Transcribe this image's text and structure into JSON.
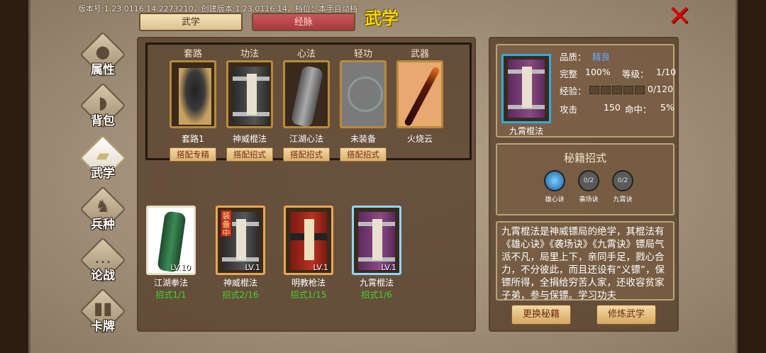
{
  "header": {
    "version_text": "版本号:1.23.0116.14.2273210，创建版本:1.23.0116.14，档位：本手自动档",
    "title": "武学",
    "close_label": "✕"
  },
  "tabs": [
    {
      "label": "武学",
      "active": true
    },
    {
      "label": "经脉",
      "active": false
    }
  ],
  "nav": [
    {
      "label": "属性",
      "icon": "person-icon",
      "active": false
    },
    {
      "label": "背包",
      "icon": "bag-icon",
      "active": false
    },
    {
      "label": "武学",
      "icon": "book-icon",
      "active": true
    },
    {
      "label": "兵种",
      "icon": "horse-rider-icon",
      "active": false
    },
    {
      "label": "论战",
      "icon": "chat-bubble-icon",
      "active": false
    },
    {
      "label": "卡牌",
      "icon": "cards-icon",
      "active": false
    }
  ],
  "equip_slots": [
    {
      "category": "套路",
      "name": "套路1",
      "button": "搭配专精",
      "art": "fighter"
    },
    {
      "category": "功法",
      "name": "神威棍法",
      "button": "搭配招式",
      "art": "book-black"
    },
    {
      "category": "心法",
      "name": "江湖心法",
      "button": "搭配招式",
      "art": "scroll"
    },
    {
      "category": "轻功",
      "name": "未装备",
      "button": "搭配招式",
      "art": "empty"
    },
    {
      "category": "武器",
      "name": "火烧云",
      "button": "",
      "art": "staff"
    }
  ],
  "inventory": [
    {
      "name": "江湖拳法",
      "moves": "招式1/1",
      "level": "LV.10",
      "equipped": false,
      "art": "scroll-green"
    },
    {
      "name": "神威棍法",
      "moves": "招式2/16",
      "level": "LV.1",
      "equipped": true,
      "equipped_label": "装备中",
      "art": "book-black"
    },
    {
      "name": "明教枪法",
      "moves": "招式1/15",
      "level": "LV.1",
      "equipped": false,
      "art": "book-red"
    },
    {
      "name": "九霄棍法",
      "moves": "招式1/6",
      "level": "LV.1",
      "equipped": false,
      "art": "book-purple"
    }
  ],
  "detail": {
    "name": "九霄棍法",
    "quality_label": "品质：",
    "quality_value": "精良",
    "complete_label": "完整",
    "complete_value": "100%",
    "level_label": "等级：",
    "level_value": "1/10",
    "exp_label": "经验：",
    "exp_value": "0/120",
    "exp_progress": 0,
    "attack_label": "攻击",
    "attack_value": "150",
    "hit_label": "命中：",
    "hit_value": "5%",
    "secret_title": "秘籍招式",
    "skills": [
      {
        "name": "雄心诀",
        "badge": "",
        "unlocked": true
      },
      {
        "name": "袭场诀",
        "badge": "0/2",
        "unlocked": false
      },
      {
        "name": "九霄诀",
        "badge": "0/2",
        "unlocked": false
      }
    ],
    "description": "九霄棍法是神威镖局的绝学，其棍法有《雄心诀》《袭场诀》《九霄诀》镖局气派不凡，局里上下，亲同手足，戮心合力，不分彼此，而且还设有“义镖”，保镖所得，全捐给穷苦人家，还收容贫家子弟，参与保镖。学习功夫",
    "buttons": {
      "swap": "更换秘籍",
      "train": "修炼武学"
    }
  },
  "colors": {
    "accent_gold": "#f5d800",
    "close_red": "#d80000",
    "green_text": "#43d42e",
    "quality_blue": "#5fb0ff"
  }
}
